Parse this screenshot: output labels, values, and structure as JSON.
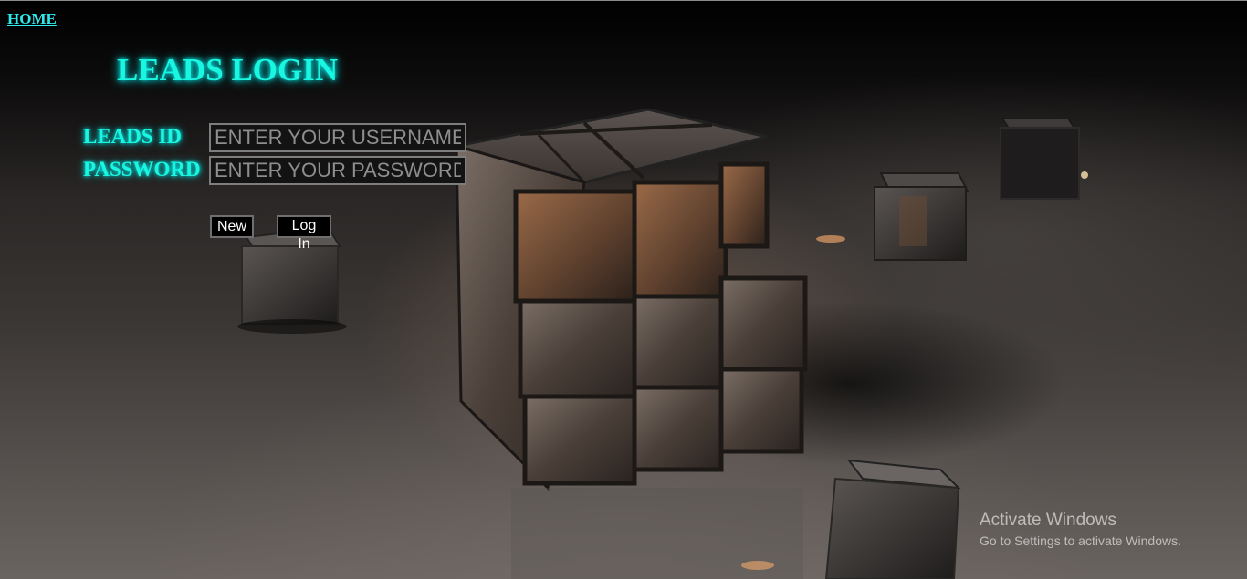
{
  "nav": {
    "home_label": "HOME"
  },
  "page": {
    "title": "LEADS LOGIN"
  },
  "form": {
    "id_label": "LEADS ID",
    "id_placeholder": "ENTER YOUR USERNAME",
    "password_label": "PASSWORD",
    "password_placeholder": "ENTER YOUR PASSWORD",
    "new_button": "New",
    "login_button": "Log In"
  },
  "watermark": {
    "title": "Activate Windows",
    "subtitle": "Go to Settings to activate Windows."
  },
  "colors": {
    "accent": "#19f7e0",
    "link": "#2fe8ea",
    "background": "#000000"
  }
}
